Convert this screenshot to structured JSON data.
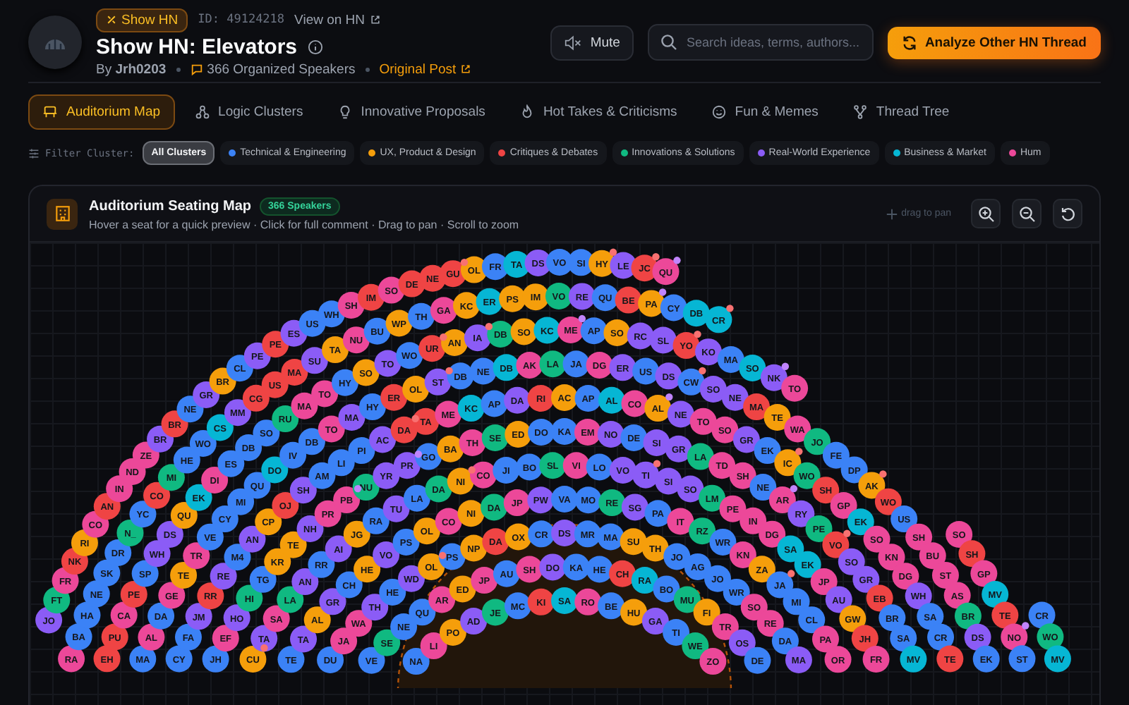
{
  "header": {
    "badge": "Show HN",
    "id": "ID: 49124218",
    "view_link": "View on HN",
    "title": "Show HN: Elevators",
    "author": "By **Jrh0203**",
    "speakers": "366 Organized Speakers",
    "original_post": "Original Post",
    "mute": "Mute",
    "search_placeholder": "Search ideas, terms, authors...",
    "analyze": "Analyze Other HN Thread"
  },
  "tabs": [
    {
      "label": "Auditorium Map",
      "kind": "seats",
      "selected": true
    },
    {
      "label": "Logic Clusters",
      "kind": "clusters",
      "selected": false
    },
    {
      "label": "Innovative Proposals",
      "kind": "bulb",
      "selected": false
    },
    {
      "label": "Hot Takes & Criticisms",
      "kind": "flame",
      "selected": false
    },
    {
      "label": "Fun & Memes",
      "kind": "smile",
      "selected": false
    },
    {
      "label": "Thread Tree",
      "kind": "tree",
      "selected": false
    }
  ],
  "filter": {
    "label": "Filter Cluster:",
    "chips": [
      {
        "label": "All Clusters",
        "selected": true
      },
      {
        "label": "Technical & Engineering",
        "selected": false,
        "color": "#3b82f6"
      },
      {
        "label": "UX, Product & Design",
        "selected": false,
        "color": "#f59e0b"
      },
      {
        "label": "Critiques & Debates",
        "selected": false,
        "color": "#ef4444"
      },
      {
        "label": "Innovations & Solutions",
        "selected": false,
        "color": "#10b981"
      },
      {
        "label": "Real-World Experience",
        "selected": false,
        "color": "#8b5cf6"
      },
      {
        "label": "Business & Market",
        "selected": false,
        "color": "#06b6d4"
      },
      {
        "label": "Hum",
        "selected": false,
        "color": "#ec4899"
      }
    ]
  },
  "map": {
    "title": "Auditorium Seating Map",
    "badge": "366 Speakers",
    "hint": "Hover a seat for a quick preview · Click for full comment · Drag to pan · Scroll to zoom",
    "pan_hint": "drag to pan",
    "rings": [
      {
        "seats": [
          {
            "label": "JO",
            "color": "#8b5cf6"
          },
          {
            "label": "FT",
            "color": "#10b981"
          },
          {
            "label": "FR",
            "color": "#ec4899"
          },
          {
            "label": "NK",
            "color": "#ef4444"
          },
          {
            "label": "RI",
            "color": "#f59e0b"
          },
          {
            "label": "CO",
            "color": "#ec4899"
          },
          {
            "label": "AN",
            "color": "#ef4444"
          },
          {
            "label": "IN",
            "color": "#ec4899"
          },
          {
            "label": "ND",
            "color": "#ec4899"
          },
          {
            "label": "ZE",
            "color": "#ec4899"
          },
          {
            "label": "BR",
            "color": "#8b5cf6"
          },
          {
            "label": "BR",
            "color": "#ef4444"
          },
          {
            "label": "NE",
            "color": "#3b82f6"
          },
          {
            "label": "GR",
            "color": "#8b5cf6"
          },
          {
            "label": "BR",
            "color": "#f59e0b"
          },
          {
            "label": "CL",
            "color": "#3b82f6"
          },
          {
            "label": "PE",
            "color": "#8b5cf6"
          },
          {
            "label": "PE",
            "color": "#ef4444"
          },
          {
            "label": "ES",
            "color": "#8b5cf6"
          },
          {
            "label": "US",
            "color": "#3b82f6"
          },
          {
            "label": "WH",
            "color": "#3b82f6"
          },
          {
            "label": "SH",
            "color": "#ec4899"
          },
          {
            "label": "IM",
            "color": "#ef4444"
          },
          {
            "label": "SO",
            "color": "#ec4899"
          },
          {
            "label": "DE",
            "color": "#ef4444"
          },
          {
            "label": "NE",
            "color": "#ef4444"
          },
          {
            "label": "GU",
            "color": "#ef4444",
            "dot": {
              "color": "#f87171"
            }
          },
          {
            "label": "OL",
            "color": "#f59e0b"
          },
          {
            "label": "FR",
            "color": "#3b82f6"
          },
          {
            "label": "TA",
            "color": "#06b6d4"
          },
          {
            "label": "DS",
            "color": "#8b5cf6"
          },
          {
            "label": "VO",
            "color": "#3b82f6"
          },
          {
            "label": "SI",
            "color": "#3b82f6"
          },
          {
            "label": "HY",
            "color": "#f59e0b",
            "dot": {
              "color": "#f87171"
            }
          },
          {
            "label": "LE",
            "color": "#8b5cf6"
          },
          {
            "label": "JC",
            "color": "#ef4444",
            "dot": {
              "color": "#f87171"
            }
          },
          {
            "label": "QU",
            "color": "#ec4899",
            "dot": {
              "color": "#c084fc"
            }
          }
        ]
      },
      {
        "seats": [
          {
            "label": "RA",
            "color": "#ec4899"
          },
          {
            "label": "BA",
            "color": "#3b82f6"
          },
          {
            "label": "HA",
            "color": "#3b82f6"
          },
          {
            "label": "NE",
            "color": "#3b82f6"
          },
          {
            "label": "SK",
            "color": "#3b82f6"
          },
          {
            "label": "DR",
            "color": "#3b82f6"
          },
          {
            "label": "N_",
            "color": "#10b981"
          },
          {
            "label": "YC",
            "color": "#3b82f6"
          },
          {
            "label": "CO",
            "color": "#ef4444"
          },
          {
            "label": "MI",
            "color": "#10b981"
          },
          {
            "label": "HE",
            "color": "#3b82f6"
          },
          {
            "label": "WO",
            "color": "#3b82f6"
          },
          {
            "label": "CS",
            "color": "#06b6d4"
          },
          {
            "label": "MM",
            "color": "#8b5cf6"
          },
          {
            "label": "CG",
            "color": "#ef4444"
          },
          {
            "label": "US",
            "color": "#ef4444"
          },
          {
            "label": "MA",
            "color": "#ef4444"
          },
          {
            "label": "SU",
            "color": "#8b5cf6"
          },
          {
            "label": "TA",
            "color": "#f59e0b"
          },
          {
            "label": "NU",
            "color": "#ec4899"
          },
          {
            "label": "BU",
            "color": "#3b82f6"
          },
          {
            "label": "WP",
            "color": "#f59e0b"
          },
          {
            "label": "TH",
            "color": "#3b82f6"
          },
          {
            "label": "GA",
            "color": "#ec4899"
          },
          {
            "label": "KC",
            "color": "#f59e0b"
          },
          {
            "label": "ER",
            "color": "#06b6d4"
          },
          {
            "label": "PS",
            "color": "#f59e0b"
          },
          {
            "label": "IM",
            "color": "#f59e0b"
          },
          {
            "label": "VO",
            "color": "#10b981"
          },
          {
            "label": "RE",
            "color": "#8b5cf6"
          },
          {
            "label": "QU",
            "color": "#3b82f6"
          },
          {
            "label": "BE",
            "color": "#ef4444"
          },
          {
            "label": "PA",
            "color": "#f59e0b",
            "dot": {
              "color": "#c084fc"
            }
          },
          {
            "label": "CY",
            "color": "#3b82f6"
          },
          {
            "label": "DB",
            "color": "#06b6d4"
          },
          {
            "label": "CR",
            "color": "#06b6d4",
            "dot": {
              "color": "#f87171"
            }
          },
          {
            "label": "CR",
            "color": "#3b82f6"
          },
          {
            "label": "WO",
            "color": "#10b981"
          },
          {
            "label": "MV",
            "color": "#06b6d4"
          }
        ]
      },
      {
        "seats": [
          {
            "label": "EH",
            "color": "#ef4444"
          },
          {
            "label": "PU",
            "color": "#ef4444"
          },
          {
            "label": "CA",
            "color": "#ec4899"
          },
          {
            "label": "PE",
            "color": "#ef4444"
          },
          {
            "label": "SP",
            "color": "#3b82f6"
          },
          {
            "label": "WH",
            "color": "#8b5cf6"
          },
          {
            "label": "DS",
            "color": "#8b5cf6"
          },
          {
            "label": "QU",
            "color": "#f59e0b"
          },
          {
            "label": "EK",
            "color": "#06b6d4"
          },
          {
            "label": "DI",
            "color": "#ec4899"
          },
          {
            "label": "ES",
            "color": "#3b82f6"
          },
          {
            "label": "DB",
            "color": "#3b82f6"
          },
          {
            "label": "SO",
            "color": "#3b82f6"
          },
          {
            "label": "RU",
            "color": "#10b981"
          },
          {
            "label": "MA",
            "color": "#ec4899"
          },
          {
            "label": "TO",
            "color": "#ec4899"
          },
          {
            "label": "HY",
            "color": "#3b82f6"
          },
          {
            "label": "SO",
            "color": "#f59e0b"
          },
          {
            "label": "TO",
            "color": "#8b5cf6"
          },
          {
            "label": "WO",
            "color": "#3b82f6"
          },
          {
            "label": "UR",
            "color": "#ef4444",
            "dot": {
              "color": "#f87171"
            }
          },
          {
            "label": "AN",
            "color": "#f59e0b"
          },
          {
            "label": "IA",
            "color": "#8b5cf6",
            "dot": {
              "color": "#f87171"
            }
          },
          {
            "label": "DB",
            "color": "#10b981"
          },
          {
            "label": "SO",
            "color": "#f59e0b"
          },
          {
            "label": "KC",
            "color": "#06b6d4"
          },
          {
            "label": "ME",
            "color": "#ec4899",
            "dot": {
              "color": "#c084fc"
            }
          },
          {
            "label": "AP",
            "color": "#3b82f6"
          },
          {
            "label": "SO",
            "color": "#f59e0b"
          },
          {
            "label": "RC",
            "color": "#8b5cf6"
          },
          {
            "label": "SL",
            "color": "#8b5cf6"
          },
          {
            "label": "YO",
            "color": "#ef4444",
            "dot": {
              "color": "#f87171"
            }
          },
          {
            "label": "KO",
            "color": "#8b5cf6"
          },
          {
            "label": "MA",
            "color": "#3b82f6"
          },
          {
            "label": "SO",
            "color": "#06b6d4"
          },
          {
            "label": "NK",
            "color": "#8b5cf6",
            "dot": {
              "color": "#c084fc"
            }
          },
          {
            "label": "TO",
            "color": "#ec4899"
          },
          {
            "label": "SO",
            "color": "#ec4899"
          },
          {
            "label": "SH",
            "color": "#ef4444"
          },
          {
            "label": "GP",
            "color": "#ec4899"
          },
          {
            "label": "MV",
            "color": "#06b6d4"
          },
          {
            "label": "TE",
            "color": "#ef4444"
          },
          {
            "label": "NO",
            "color": "#ec4899",
            "dot": {
              "color": "#c084fc"
            }
          },
          {
            "label": "ST",
            "color": "#3b82f6"
          }
        ]
      },
      {
        "seats": [
          {
            "label": "MA",
            "color": "#3b82f6"
          },
          {
            "label": "AL",
            "color": "#ec4899"
          },
          {
            "label": "DA",
            "color": "#3b82f6"
          },
          {
            "label": "GE",
            "color": "#ec4899"
          },
          {
            "label": "TE",
            "color": "#f59e0b"
          },
          {
            "label": "TR",
            "color": "#ec4899"
          },
          {
            "label": "VE",
            "color": "#3b82f6"
          },
          {
            "label": "CY",
            "color": "#3b82f6"
          },
          {
            "label": "MI",
            "color": "#3b82f6"
          },
          {
            "label": "QU",
            "color": "#3b82f6"
          },
          {
            "label": "DO",
            "color": "#06b6d4"
          },
          {
            "label": "IV",
            "color": "#3b82f6"
          },
          {
            "label": "DB",
            "color": "#3b82f6"
          },
          {
            "label": "TO",
            "color": "#ec4899"
          },
          {
            "label": "MA",
            "color": "#8b5cf6"
          },
          {
            "label": "HY",
            "color": "#3b82f6"
          },
          {
            "label": "ER",
            "color": "#ef4444"
          },
          {
            "label": "OL",
            "color": "#f59e0b"
          },
          {
            "label": "ST",
            "color": "#8b5cf6",
            "dot": {
              "color": "#f87171"
            }
          },
          {
            "label": "DB",
            "color": "#3b82f6"
          },
          {
            "label": "NE",
            "color": "#3b82f6"
          },
          {
            "label": "DB",
            "color": "#06b6d4"
          },
          {
            "label": "AK",
            "color": "#ec4899"
          },
          {
            "label": "LA",
            "color": "#10b981"
          },
          {
            "label": "JA",
            "color": "#3b82f6"
          },
          {
            "label": "DG",
            "color": "#ec4899"
          },
          {
            "label": "ER",
            "color": "#8b5cf6"
          },
          {
            "label": "US",
            "color": "#3b82f6"
          },
          {
            "label": "DS",
            "color": "#8b5cf6"
          },
          {
            "label": "CW",
            "color": "#3b82f6",
            "dot": {
              "color": "#f87171"
            }
          },
          {
            "label": "SO",
            "color": "#8b5cf6"
          },
          {
            "label": "NE",
            "color": "#8b5cf6"
          },
          {
            "label": "MA",
            "color": "#ef4444"
          },
          {
            "label": "TE",
            "color": "#f59e0b"
          },
          {
            "label": "WA",
            "color": "#ec4899"
          },
          {
            "label": "JO",
            "color": "#10b981"
          },
          {
            "label": "FE",
            "color": "#3b82f6"
          },
          {
            "label": "DP",
            "color": "#3b82f6"
          },
          {
            "label": "AK",
            "color": "#f59e0b",
            "dot": {
              "color": "#f87171"
            }
          },
          {
            "label": "WO",
            "color": "#ef4444"
          },
          {
            "label": "US",
            "color": "#3b82f6"
          },
          {
            "label": "SH",
            "color": "#ec4899"
          },
          {
            "label": "BU",
            "color": "#ec4899"
          },
          {
            "label": "ST",
            "color": "#ec4899"
          },
          {
            "label": "AS",
            "color": "#ec4899"
          },
          {
            "label": "BR",
            "color": "#10b981"
          },
          {
            "label": "DS",
            "color": "#8b5cf6"
          },
          {
            "label": "EK",
            "color": "#3b82f6"
          }
        ]
      },
      {
        "seats": [
          {
            "label": "CY",
            "color": "#3b82f6"
          },
          {
            "label": "FA",
            "color": "#3b82f6"
          },
          {
            "label": "JM",
            "color": "#8b5cf6"
          },
          {
            "label": "RR",
            "color": "#ef4444"
          },
          {
            "label": "RE",
            "color": "#8b5cf6"
          },
          {
            "label": "M4",
            "color": "#3b82f6"
          },
          {
            "label": "AN",
            "color": "#8b5cf6"
          },
          {
            "label": "CP",
            "color": "#f59e0b"
          },
          {
            "label": "OJ",
            "color": "#ef4444"
          },
          {
            "label": "SH",
            "color": "#8b5cf6"
          },
          {
            "label": "AM",
            "color": "#3b82f6"
          },
          {
            "label": "LI",
            "color": "#3b82f6"
          },
          {
            "label": "PI",
            "color": "#3b82f6"
          },
          {
            "label": "AC",
            "color": "#8b5cf6"
          },
          {
            "label": "DA",
            "color": "#ef4444",
            "dot": {
              "color": "#f87171"
            }
          },
          {
            "label": "TA",
            "color": "#ef4444"
          },
          {
            "label": "ME",
            "color": "#ec4899"
          },
          {
            "label": "KC",
            "color": "#06b6d4"
          },
          {
            "label": "AP",
            "color": "#3b82f6"
          },
          {
            "label": "DA",
            "color": "#8b5cf6"
          },
          {
            "label": "RI",
            "color": "#ef4444"
          },
          {
            "label": "AC",
            "color": "#f59e0b"
          },
          {
            "label": "AP",
            "color": "#3b82f6"
          },
          {
            "label": "AL",
            "color": "#06b6d4"
          },
          {
            "label": "CO",
            "color": "#ec4899"
          },
          {
            "label": "AL",
            "color": "#f59e0b",
            "dot": {
              "color": "#c084fc"
            }
          },
          {
            "label": "NE",
            "color": "#8b5cf6"
          },
          {
            "label": "TO",
            "color": "#ec4899"
          },
          {
            "label": "SO",
            "color": "#ec4899"
          },
          {
            "label": "GR",
            "color": "#8b5cf6"
          },
          {
            "label": "EK",
            "color": "#3b82f6"
          },
          {
            "label": "IC",
            "color": "#f59e0b",
            "dot": {
              "color": "#f87171"
            }
          },
          {
            "label": "WO",
            "color": "#10b981"
          },
          {
            "label": "SH",
            "color": "#ef4444"
          },
          {
            "label": "GP",
            "color": "#ec4899"
          },
          {
            "label": "EK",
            "color": "#06b6d4"
          },
          {
            "label": "SO",
            "color": "#ec4899"
          },
          {
            "label": "KN",
            "color": "#ec4899"
          },
          {
            "label": "DG",
            "color": "#ec4899"
          },
          {
            "label": "WH",
            "color": "#8b5cf6"
          },
          {
            "label": "SA",
            "color": "#3b82f6"
          },
          {
            "label": "CR",
            "color": "#3b82f6"
          },
          {
            "label": "TE",
            "color": "#ef4444"
          }
        ]
      },
      {
        "seats": [
          {
            "label": "JH",
            "color": "#3b82f6"
          },
          {
            "label": "EF",
            "color": "#ec4899"
          },
          {
            "label": "HO",
            "color": "#8b5cf6"
          },
          {
            "label": "HI",
            "color": "#10b981"
          },
          {
            "label": "TG",
            "color": "#3b82f6"
          },
          {
            "label": "KR",
            "color": "#f59e0b"
          },
          {
            "label": "TE",
            "color": "#f59e0b"
          },
          {
            "label": "NH",
            "color": "#8b5cf6"
          },
          {
            "label": "PR",
            "color": "#ec4899"
          },
          {
            "label": "PB",
            "color": "#ec4899",
            "dot": {
              "color": "#c084fc"
            }
          },
          {
            "label": "NU",
            "color": "#10b981"
          },
          {
            "label": "YR",
            "color": "#8b5cf6"
          },
          {
            "label": "PR",
            "color": "#8b5cf6",
            "dot": {
              "color": "#c084fc"
            }
          },
          {
            "label": "GO",
            "color": "#3b82f6"
          },
          {
            "label": "BA",
            "color": "#f59e0b"
          },
          {
            "label": "TH",
            "color": "#ec4899"
          },
          {
            "label": "SE",
            "color": "#10b981"
          },
          {
            "label": "ED",
            "color": "#f59e0b"
          },
          {
            "label": "DO",
            "color": "#3b82f6"
          },
          {
            "label": "KA",
            "color": "#3b82f6"
          },
          {
            "label": "EM",
            "color": "#ec4899"
          },
          {
            "label": "NO",
            "color": "#8b5cf6"
          },
          {
            "label": "DE",
            "color": "#3b82f6"
          },
          {
            "label": "SI",
            "color": "#8b5cf6"
          },
          {
            "label": "GR",
            "color": "#8b5cf6"
          },
          {
            "label": "LA",
            "color": "#10b981"
          },
          {
            "label": "TD",
            "color": "#ec4899"
          },
          {
            "label": "SH",
            "color": "#ec4899"
          },
          {
            "label": "NE",
            "color": "#3b82f6"
          },
          {
            "label": "AR",
            "color": "#ec4899",
            "dot": {
              "color": "#c084fc"
            }
          },
          {
            "label": "RY",
            "color": "#8b5cf6"
          },
          {
            "label": "PE",
            "color": "#10b981"
          },
          {
            "label": "VO",
            "color": "#ef4444",
            "dot": {
              "color": "#f87171"
            }
          },
          {
            "label": "SO",
            "color": "#8b5cf6"
          },
          {
            "label": "GR",
            "color": "#8b5cf6"
          },
          {
            "label": "EB",
            "color": "#ef4444"
          },
          {
            "label": "BR",
            "color": "#3b82f6"
          },
          {
            "label": "SA",
            "color": "#3b82f6"
          },
          {
            "label": "MV",
            "color": "#06b6d4"
          }
        ]
      },
      {
        "seats": [
          {
            "label": "CU",
            "color": "#f59e0b",
            "dot": {
              "color": "#f87171"
            }
          },
          {
            "label": "TA",
            "color": "#8b5cf6"
          },
          {
            "label": "SA",
            "color": "#ec4899"
          },
          {
            "label": "LA",
            "color": "#10b981"
          },
          {
            "label": "AN",
            "color": "#8b5cf6"
          },
          {
            "label": "RR",
            "color": "#3b82f6"
          },
          {
            "label": "AI",
            "color": "#8b5cf6"
          },
          {
            "label": "JG",
            "color": "#f59e0b"
          },
          {
            "label": "RA",
            "color": "#3b82f6"
          },
          {
            "label": "TU",
            "color": "#8b5cf6"
          },
          {
            "label": "LA",
            "color": "#3b82f6"
          },
          {
            "label": "DA",
            "color": "#10b981"
          },
          {
            "label": "NI",
            "color": "#f59e0b",
            "dot": {
              "color": "#f87171"
            }
          },
          {
            "label": "CO",
            "color": "#ec4899"
          },
          {
            "label": "JI",
            "color": "#3b82f6"
          },
          {
            "label": "BO",
            "color": "#3b82f6"
          },
          {
            "label": "SL",
            "color": "#10b981"
          },
          {
            "label": "VI",
            "color": "#ec4899"
          },
          {
            "label": "LO",
            "color": "#3b82f6"
          },
          {
            "label": "VO",
            "color": "#8b5cf6"
          },
          {
            "label": "TI",
            "color": "#8b5cf6",
            "dot": {
              "color": "#f87171"
            }
          },
          {
            "label": "SI",
            "color": "#8b5cf6"
          },
          {
            "label": "SO",
            "color": "#8b5cf6"
          },
          {
            "label": "LM",
            "color": "#10b981"
          },
          {
            "label": "PE",
            "color": "#ec4899"
          },
          {
            "label": "IN",
            "color": "#ec4899"
          },
          {
            "label": "DG",
            "color": "#ec4899"
          },
          {
            "label": "SA",
            "color": "#06b6d4"
          },
          {
            "label": "EK",
            "color": "#06b6d4"
          },
          {
            "label": "JP",
            "color": "#ec4899"
          },
          {
            "label": "AU",
            "color": "#8b5cf6"
          },
          {
            "label": "GW",
            "color": "#f59e0b"
          },
          {
            "label": "JH",
            "color": "#ef4444"
          },
          {
            "label": "FR",
            "color": "#ec4899"
          }
        ]
      },
      {
        "seats": [
          {
            "label": "TE",
            "color": "#3b82f6"
          },
          {
            "label": "TA",
            "color": "#8b5cf6"
          },
          {
            "label": "AL",
            "color": "#f59e0b"
          },
          {
            "label": "GR",
            "color": "#8b5cf6"
          },
          {
            "label": "CH",
            "color": "#3b82f6"
          },
          {
            "label": "HE",
            "color": "#f59e0b"
          },
          {
            "label": "VO",
            "color": "#8b5cf6"
          },
          {
            "label": "PS",
            "color": "#3b82f6"
          },
          {
            "label": "OL",
            "color": "#f59e0b"
          },
          {
            "label": "CO",
            "color": "#ec4899"
          },
          {
            "label": "NI",
            "color": "#f59e0b"
          },
          {
            "label": "DA",
            "color": "#10b981"
          },
          {
            "label": "JP",
            "color": "#ec4899"
          },
          {
            "label": "PW",
            "color": "#8b5cf6"
          },
          {
            "label": "VA",
            "color": "#3b82f6"
          },
          {
            "label": "MO",
            "color": "#3b82f6"
          },
          {
            "label": "RE",
            "color": "#10b981"
          },
          {
            "label": "SG",
            "color": "#8b5cf6"
          },
          {
            "label": "PA",
            "color": "#3b82f6"
          },
          {
            "label": "IT",
            "color": "#ec4899"
          },
          {
            "label": "RZ",
            "color": "#10b981"
          },
          {
            "label": "WR",
            "color": "#3b82f6"
          },
          {
            "label": "KN",
            "color": "#ec4899"
          },
          {
            "label": "ZA",
            "color": "#f59e0b"
          },
          {
            "label": "JA",
            "color": "#3b82f6",
            "dot": {
              "color": "#f87171"
            }
          },
          {
            "label": "MI",
            "color": "#3b82f6"
          },
          {
            "label": "CL",
            "color": "#3b82f6"
          },
          {
            "label": "PA",
            "color": "#ec4899"
          },
          {
            "label": "OR",
            "color": "#ec4899"
          }
        ]
      },
      {
        "seats": [
          {
            "label": "DU",
            "color": "#3b82f6"
          },
          {
            "label": "JA",
            "color": "#ec4899"
          },
          {
            "label": "WA",
            "color": "#ec4899"
          },
          {
            "label": "TH",
            "color": "#8b5cf6"
          },
          {
            "label": "HE",
            "color": "#3b82f6"
          },
          {
            "label": "WD",
            "color": "#8b5cf6"
          },
          {
            "label": "OL",
            "color": "#f59e0b",
            "dot": {
              "color": "#f87171"
            }
          },
          {
            "label": "PS",
            "color": "#3b82f6"
          },
          {
            "label": "NP",
            "color": "#f59e0b"
          },
          {
            "label": "DA",
            "color": "#ef4444"
          },
          {
            "label": "OX",
            "color": "#f59e0b"
          },
          {
            "label": "CR",
            "color": "#3b82f6"
          },
          {
            "label": "DS",
            "color": "#8b5cf6"
          },
          {
            "label": "MR",
            "color": "#3b82f6"
          },
          {
            "label": "MA",
            "color": "#3b82f6"
          },
          {
            "label": "SU",
            "color": "#f59e0b"
          },
          {
            "label": "TH",
            "color": "#f59e0b"
          },
          {
            "label": "JO",
            "color": "#3b82f6"
          },
          {
            "label": "AG",
            "color": "#3b82f6"
          },
          {
            "label": "JO",
            "color": "#3b82f6"
          },
          {
            "label": "WR",
            "color": "#3b82f6"
          },
          {
            "label": "SO",
            "color": "#ec4899"
          },
          {
            "label": "RE",
            "color": "#ec4899"
          },
          {
            "label": "DA",
            "color": "#3b82f6"
          },
          {
            "label": "MA",
            "color": "#8b5cf6"
          }
        ]
      },
      {
        "seats": [
          {
            "label": "VE",
            "color": "#3b82f6"
          },
          {
            "label": "SE",
            "color": "#10b981"
          },
          {
            "label": "NE",
            "color": "#3b82f6"
          },
          {
            "label": "QU",
            "color": "#3b82f6"
          },
          {
            "label": "AR",
            "color": "#ec4899"
          },
          {
            "label": "ED",
            "color": "#f59e0b"
          },
          {
            "label": "JP",
            "color": "#ec4899"
          },
          {
            "label": "AU",
            "color": "#3b82f6"
          },
          {
            "label": "SH",
            "color": "#ec4899"
          },
          {
            "label": "DO",
            "color": "#8b5cf6"
          },
          {
            "label": "KA",
            "color": "#3b82f6"
          },
          {
            "label": "HE",
            "color": "#3b82f6"
          },
          {
            "label": "CH",
            "color": "#ef4444"
          },
          {
            "label": "RA",
            "color": "#06b6d4"
          },
          {
            "label": "BO",
            "color": "#3b82f6"
          },
          {
            "label": "MU",
            "color": "#10b981"
          },
          {
            "label": "FI",
            "color": "#f59e0b"
          },
          {
            "label": "TR",
            "color": "#ec4899"
          },
          {
            "label": "OS",
            "color": "#8b5cf6"
          },
          {
            "label": "DE",
            "color": "#3b82f6"
          }
        ]
      },
      {
        "seats": [
          {
            "label": "NA",
            "color": "#3b82f6"
          },
          {
            "label": "LI",
            "color": "#ec4899"
          },
          {
            "label": "PO",
            "color": "#f59e0b"
          },
          {
            "label": "AD",
            "color": "#8b5cf6"
          },
          {
            "label": "JE",
            "color": "#10b981"
          },
          {
            "label": "MC",
            "color": "#3b82f6"
          },
          {
            "label": "KI",
            "color": "#ef4444"
          },
          {
            "label": "SA",
            "color": "#06b6d4"
          },
          {
            "label": "RO",
            "color": "#ec4899"
          },
          {
            "label": "BE",
            "color": "#3b82f6"
          },
          {
            "label": "HU",
            "color": "#f59e0b"
          },
          {
            "label": "GA",
            "color": "#8b5cf6"
          },
          {
            "label": "TI",
            "color": "#3b82f6"
          },
          {
            "label": "WE",
            "color": "#10b981"
          },
          {
            "label": "ZO",
            "color": "#ec4899"
          }
        ]
      }
    ]
  }
}
